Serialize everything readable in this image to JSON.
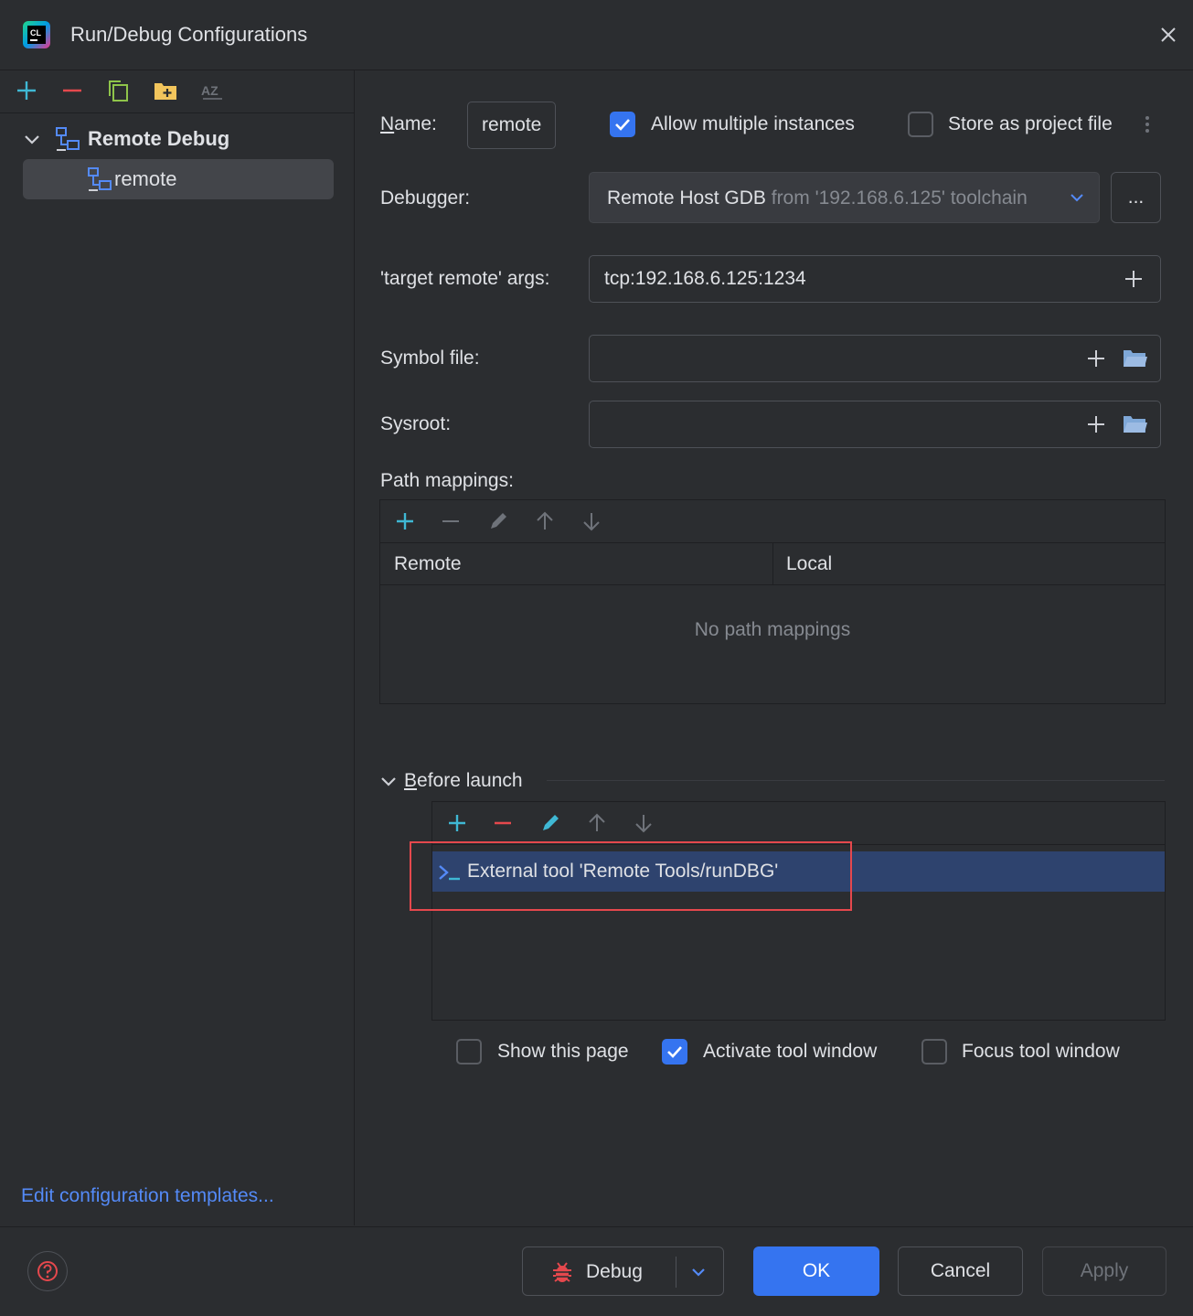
{
  "window": {
    "title": "Run/Debug Configurations",
    "app_icon_text": "CL"
  },
  "sidebar": {
    "group_label": "Remote Debug",
    "item_label": "remote",
    "edit_templates_link": "Edit configuration templates..."
  },
  "form": {
    "name_label": "Name:",
    "name_value": "remote",
    "allow_multiple_label": "Allow multiple instances",
    "allow_multiple_checked": true,
    "store_project_label": "Store as project file",
    "store_project_checked": false,
    "debugger_label": "Debugger:",
    "debugger_value": "Remote Host GDB",
    "debugger_suffix": "from '192.168.6.125' toolchain",
    "debugger_more_button": "...",
    "target_remote_label": "'target remote' args:",
    "target_remote_value": "tcp:192.168.6.125:1234",
    "symbol_file_label": "Symbol file:",
    "symbol_file_value": "",
    "sysroot_label": "Sysroot:",
    "sysroot_value": ""
  },
  "path_mappings": {
    "label": "Path mappings:",
    "columns": [
      "Remote",
      "Local"
    ],
    "empty_text": "No path mappings"
  },
  "before_launch": {
    "label": "Before launch",
    "tasks": [
      "External tool 'Remote Tools/runDBG'"
    ],
    "show_page_label": "Show this page",
    "show_page_checked": false,
    "activate_tool_label": "Activate tool window",
    "activate_tool_checked": true,
    "focus_tool_label": "Focus tool window",
    "focus_tool_checked": false
  },
  "footer": {
    "debug_label": "Debug",
    "ok_label": "OK",
    "cancel_label": "Cancel",
    "apply_label": "Apply"
  },
  "colors": {
    "background": "#2b2d30",
    "accent": "#3574f0",
    "selection": "#2e436e",
    "highlight_border": "#e5484d",
    "add_icon": "#3fb8d4",
    "remove_icon": "#e5484d"
  },
  "icons": [
    "clion-app-icon",
    "close-icon",
    "add-icon",
    "remove-icon",
    "copy-icon",
    "folder-add-icon",
    "sort-az-icon",
    "chevron-down-icon",
    "remote-debug-icon",
    "plus-icon",
    "folder-icon",
    "edit-icon",
    "arrow-up-icon",
    "arrow-down-icon",
    "terminal-icon",
    "bug-icon",
    "help-icon"
  ]
}
